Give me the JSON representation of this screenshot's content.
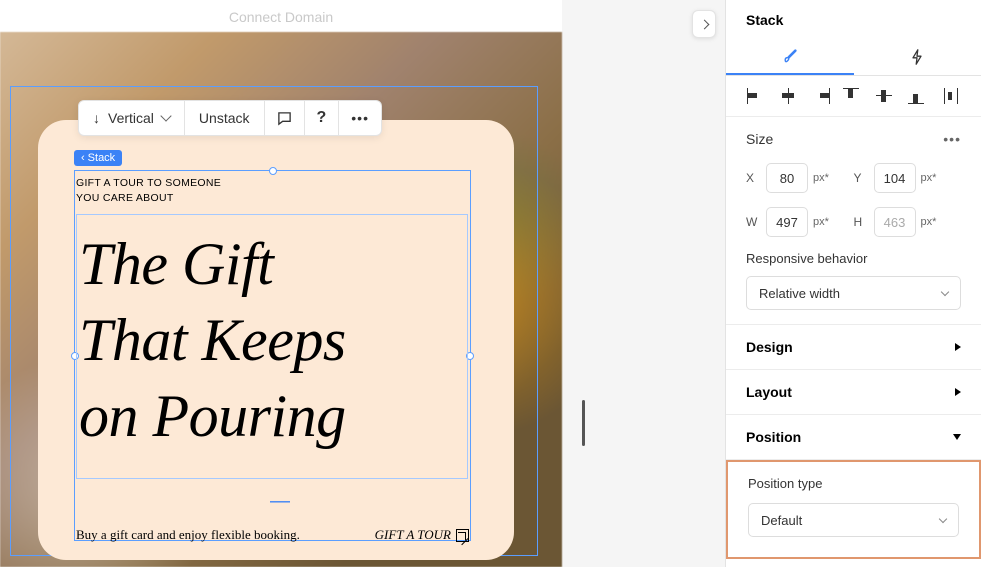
{
  "header": {
    "connect_domain": "Connect Domain"
  },
  "toolbar": {
    "direction_label": "Vertical",
    "unstack_label": "Unstack"
  },
  "badge": {
    "stack_label": "Stack"
  },
  "content": {
    "overline_line1": "GIFT A TOUR TO SOMEONE",
    "overline_line2": "YOU CARE ABOUT",
    "headline_line1": "The Gift",
    "headline_line2": "That Keeps",
    "headline_line3": "on Pouring",
    "footer_text": "Buy a gift card and enjoy flexible booking.",
    "cta_label": "GIFT A TOUR"
  },
  "inspector": {
    "title": "Stack",
    "size": {
      "label": "Size",
      "x": "80",
      "y": "104",
      "w": "497",
      "h": "463",
      "unit": "px*"
    },
    "responsive": {
      "label": "Responsive behavior",
      "value": "Relative width"
    },
    "sections": {
      "design": "Design",
      "layout": "Layout",
      "position": "Position"
    },
    "position": {
      "type_label": "Position type",
      "type_value": "Default"
    }
  }
}
